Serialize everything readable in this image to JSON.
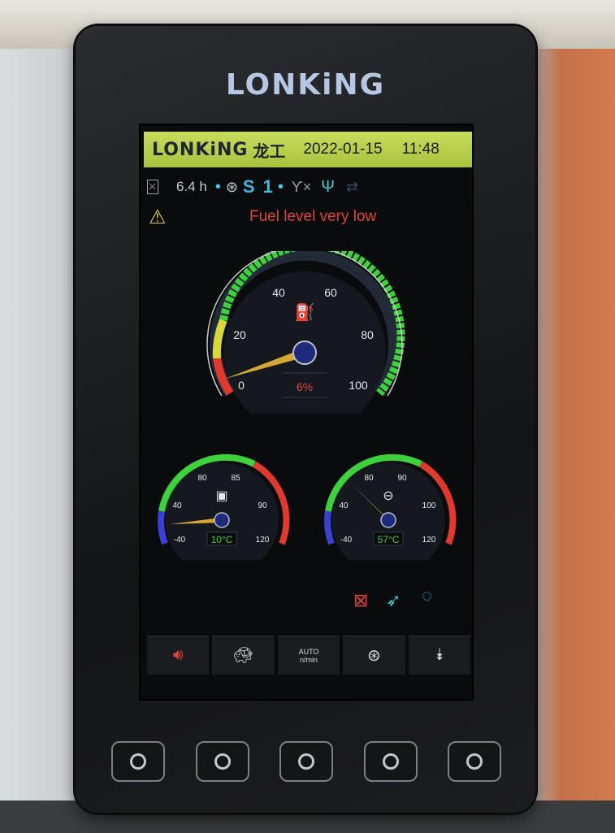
{
  "device": {
    "brand": "LONKiNG"
  },
  "header": {
    "brand": "LONKiNG",
    "brand_cn": "龙工",
    "date": "2022-01-15",
    "time": "11:48"
  },
  "status": {
    "hours": "6.4 h",
    "mode_letter": "S",
    "mode_number": "1"
  },
  "warning": {
    "text": "Fuel level very low"
  },
  "fuel_gauge": {
    "ticks": [
      "0",
      "20",
      "40",
      "60",
      "80",
      "100"
    ],
    "value_label": "6%",
    "value": 6
  },
  "coolant_gauge": {
    "ticks": [
      "-40",
      "40",
      "80",
      "85",
      "90",
      "120"
    ],
    "value_label": "10°C",
    "value": 10
  },
  "oil_gauge": {
    "ticks": [
      "-40",
      "40",
      "80",
      "90",
      "100",
      "120"
    ],
    "value_label": "57°C",
    "value": 57
  },
  "bottom_bar": {
    "auto_label": "AUTO",
    "rpm_label": "n/min"
  },
  "colors": {
    "header_bg": "#b6d04a",
    "warning_text": "#e0453d",
    "gauge_green": "#3ed23a",
    "gauge_red": "#e03a2e",
    "needle": "#d6a833"
  }
}
